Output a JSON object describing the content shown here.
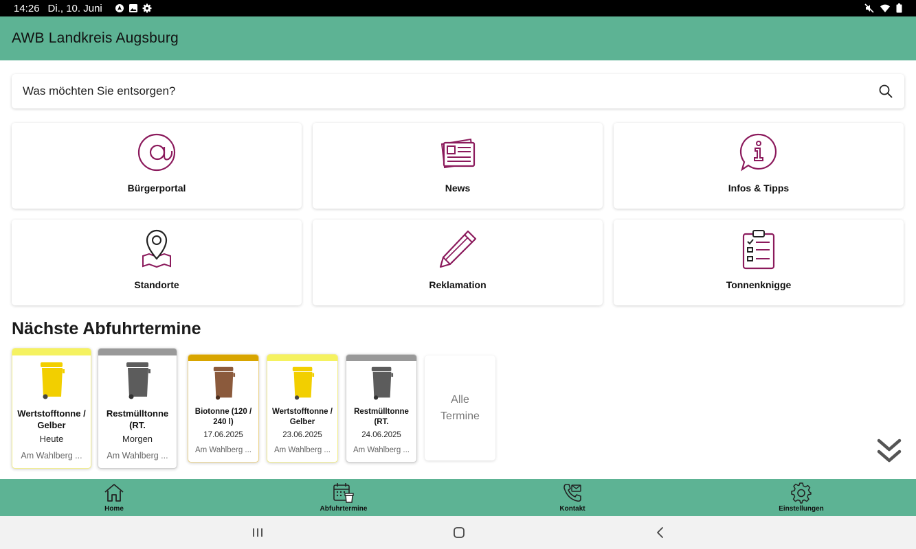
{
  "status": {
    "time": "14:26",
    "date": "Di., 10. Juni",
    "left_icons": [
      "location-icon",
      "image-icon",
      "settings-icon"
    ],
    "right_icons": [
      "mute-icon",
      "wifi-icon",
      "battery-icon"
    ]
  },
  "app": {
    "title": "AWB Landkreis Augsburg",
    "accent": "#5db394",
    "icon_color": "#8b1a5c"
  },
  "search": {
    "placeholder": "Was möchten Sie entsorgen?"
  },
  "tiles": [
    {
      "label": "Bürgerportal",
      "icon": "at-icon"
    },
    {
      "label": "News",
      "icon": "newspaper-icon"
    },
    {
      "label": "Infos & Tipps",
      "icon": "info-bubble-icon"
    },
    {
      "label": "Standorte",
      "icon": "map-pin-icon"
    },
    {
      "label": "Reklamation",
      "icon": "pencil-icon"
    },
    {
      "label": "Tonnenknigge",
      "icon": "checklist-icon"
    }
  ],
  "section_title": "Nächste Abfuhrtermine",
  "pickups": [
    {
      "title": "Wertstofftonne / Gelber",
      "date": "Heute",
      "address": "Am Wahlberg ...",
      "bar_color": "#f5f260",
      "bin_color": "#f2cf00",
      "border_color": "#f3ee8a"
    },
    {
      "title": "Restmülltonne (RT.",
      "date": "Morgen",
      "address": "Am Wahlberg ...",
      "bar_color": "#999999",
      "bin_color": "#5c5c5c",
      "border_color": "#cfcfcf"
    },
    {
      "title": "Biotonne (120 / 240 l)",
      "date": "17.06.2025",
      "address": "Am Wahlberg ...",
      "bar_color": "#d8a500",
      "bin_color": "#8b5a3c",
      "border_color": "#ecd38a"
    },
    {
      "title": "Wertstofftonne / Gelber",
      "date": "23.06.2025",
      "address": "Am Wahlberg ...",
      "bar_color": "#f5f260",
      "bin_color": "#f2cf00",
      "border_color": "#f3ee8a"
    },
    {
      "title": "Restmülltonne (RT.",
      "date": "24.06.2025",
      "address": "Am Wahlberg ...",
      "bar_color": "#999999",
      "bin_color": "#5c5c5c",
      "border_color": "#cfcfcf"
    }
  ],
  "all_dates": {
    "line1": "Alle",
    "line2": "Termine"
  },
  "nav": [
    {
      "label": "Home",
      "icon": "home-icon"
    },
    {
      "label": "Abfuhrtermine",
      "icon": "calendar-bin-icon"
    },
    {
      "label": "Kontakt",
      "icon": "phone-icon"
    },
    {
      "label": "Einstellungen",
      "icon": "gear-icon"
    }
  ],
  "system_nav": [
    "recents-icon",
    "home-circle-icon",
    "back-icon"
  ]
}
